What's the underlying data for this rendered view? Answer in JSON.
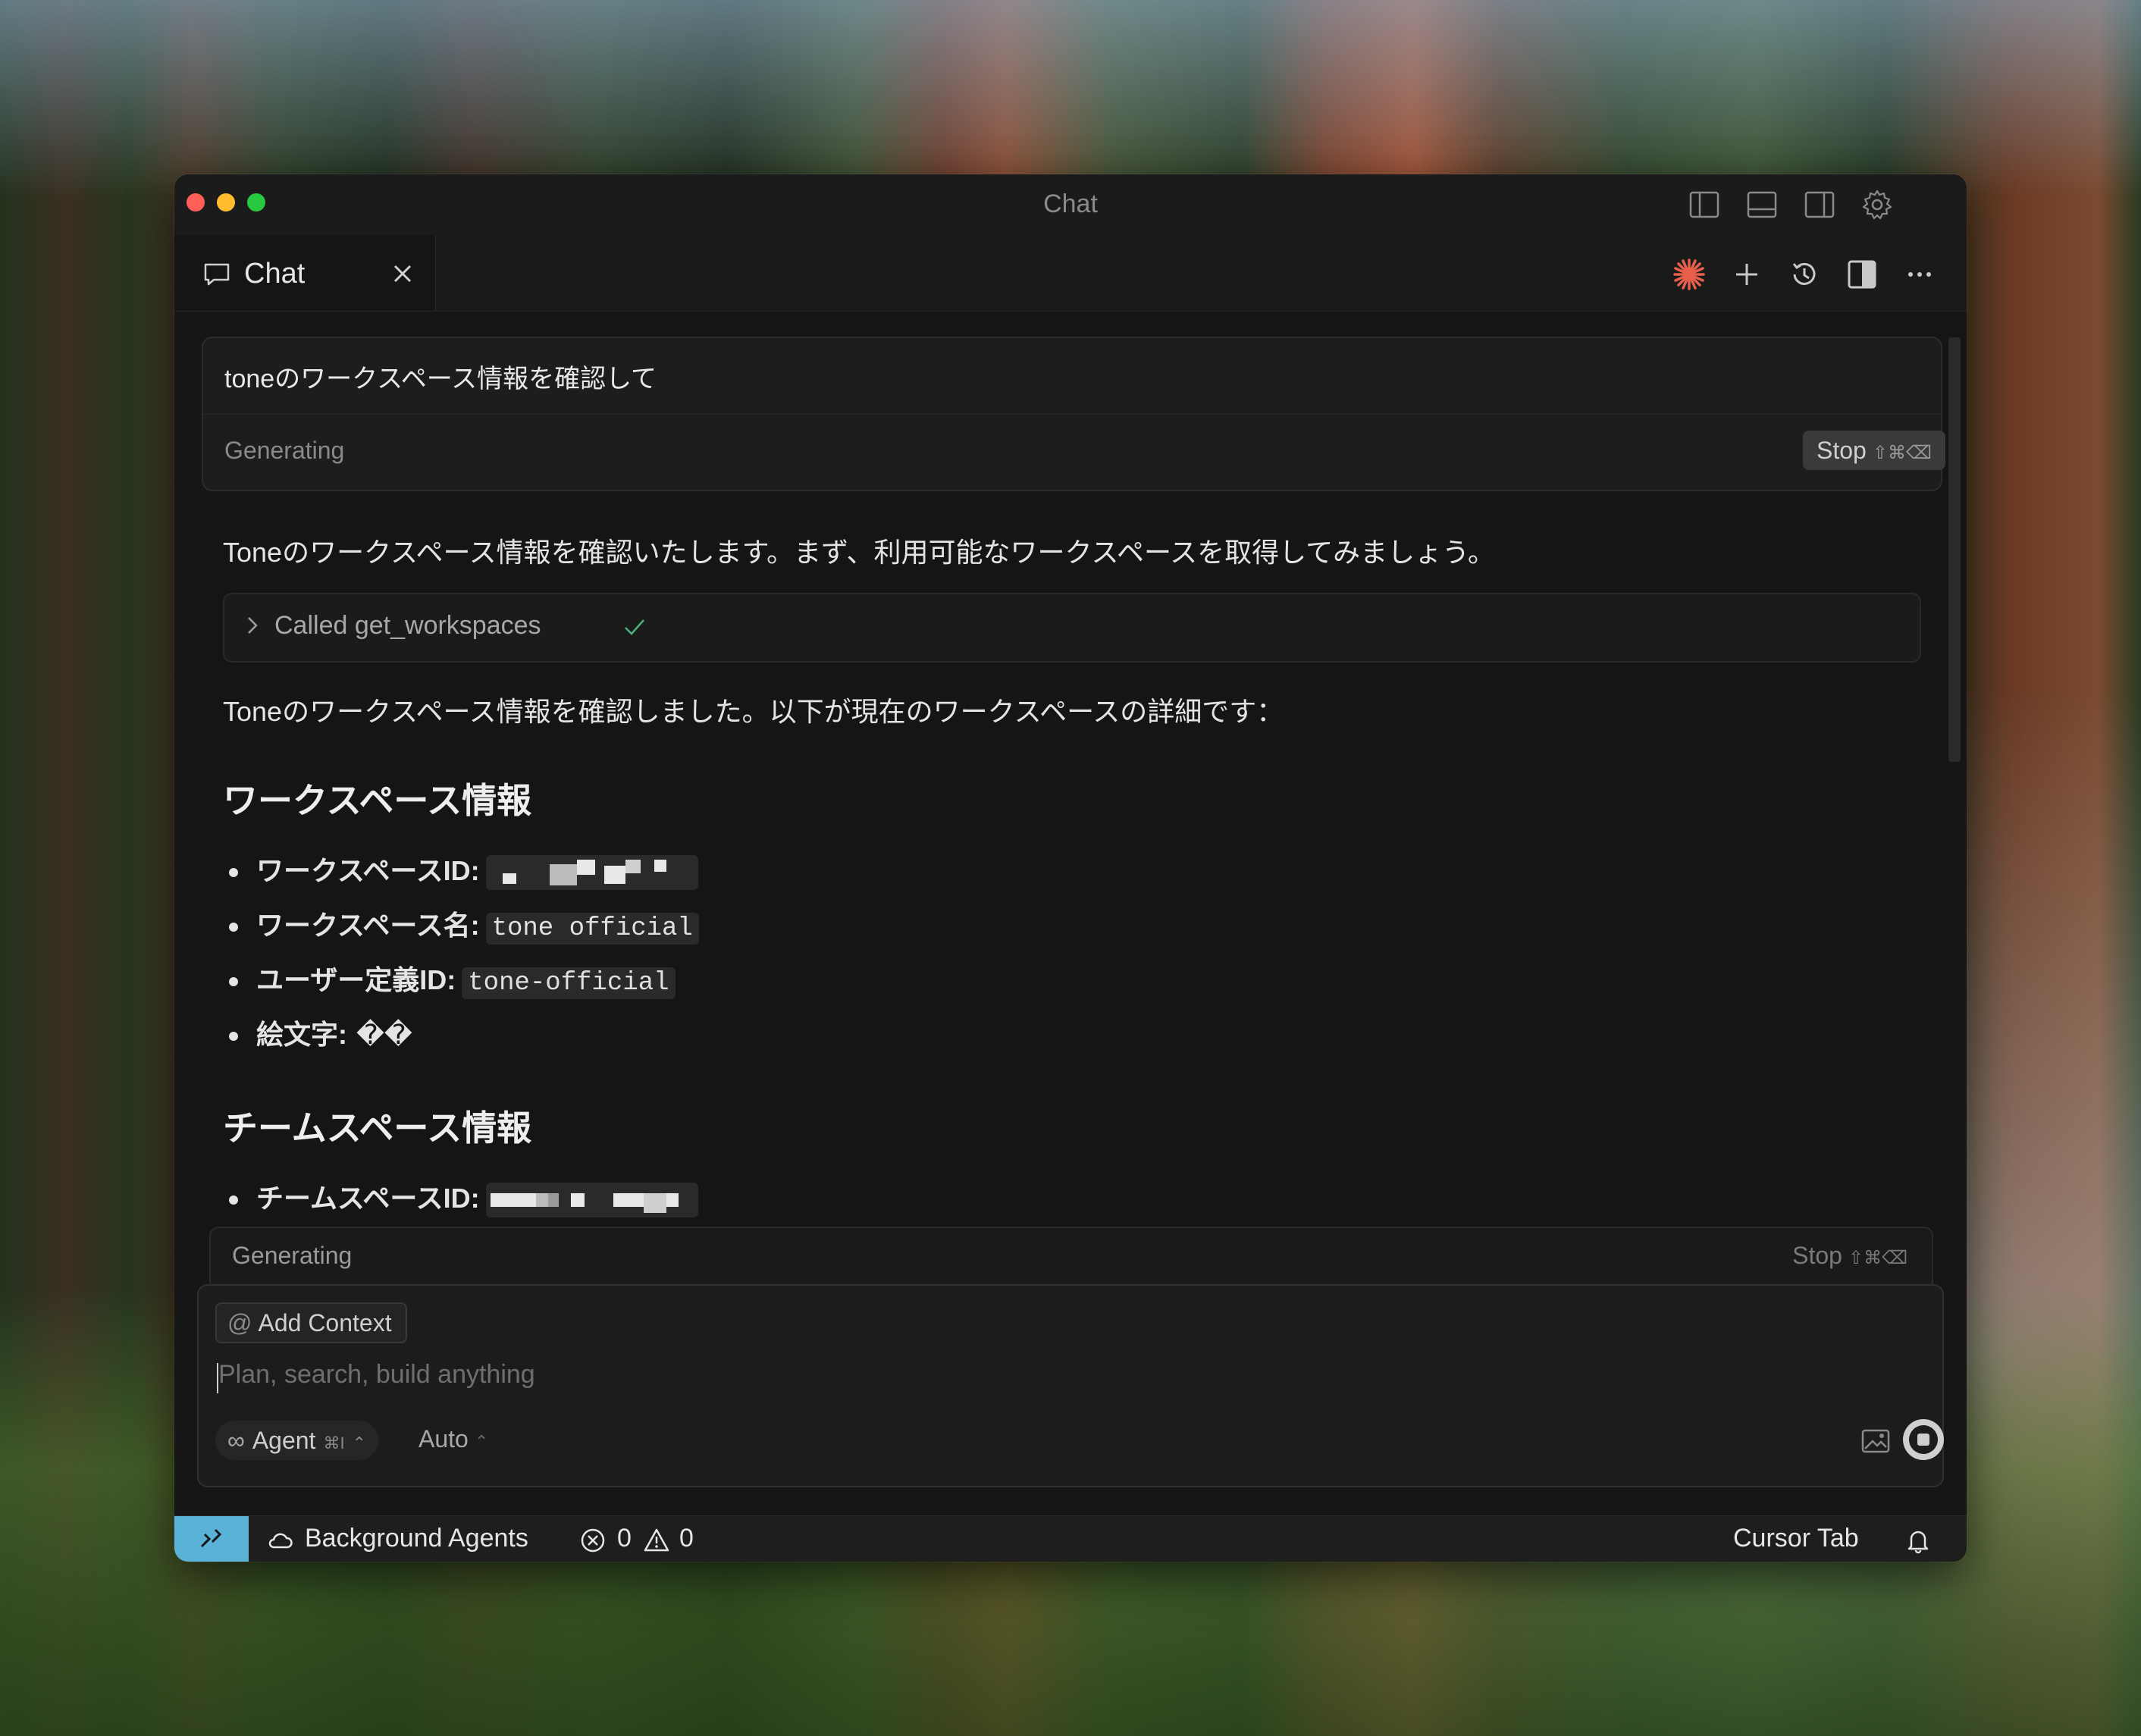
{
  "window": {
    "title": "Chat"
  },
  "tab": {
    "label": "Chat"
  },
  "query": {
    "text": "toneのワークスペース情報を確認して",
    "status": "Generating",
    "stop_label": "Stop",
    "stop_shortcut": "⇧⌘⌫"
  },
  "response": {
    "intro": "Toneのワークスペース情報を確認いたします。まず、利用可能なワークスペースを取得してみましょう。",
    "tool_call": "Called get_workspaces",
    "summary": "Toneのワークスペース情報を確認しました。以下が現在のワークスペースの詳細です：",
    "section1_title": "ワークスペース情報",
    "items1": [
      {
        "label": "ワークスペースID:",
        "value": ""
      },
      {
        "label": "ワークスペース名:",
        "value": "tone official"
      },
      {
        "label": "ユーザー定義ID:",
        "value": "tone-official"
      },
      {
        "label": "絵文字:",
        "value": "��"
      }
    ],
    "section2_title": "チームスペース情報",
    "items2": [
      {
        "label": "チームスペースID:",
        "value": ""
      }
    ]
  },
  "generating_bar": {
    "status": "Generating",
    "stop_label": "Stop",
    "stop_shortcut": "⇧⌘⌫"
  },
  "composer": {
    "add_context": "Add Context",
    "placeholder": "Plan, search, build anything",
    "agent_label": "Agent",
    "agent_shortcut": "⌘I",
    "model_label": "Auto"
  },
  "statusbar": {
    "background_agents": "Background Agents",
    "errors": "0",
    "warnings": "0",
    "cursor_tab": "Cursor Tab"
  },
  "colors": {
    "accent": "#e8604c",
    "remote": "#5ab3d6",
    "success": "#4caf7a"
  }
}
